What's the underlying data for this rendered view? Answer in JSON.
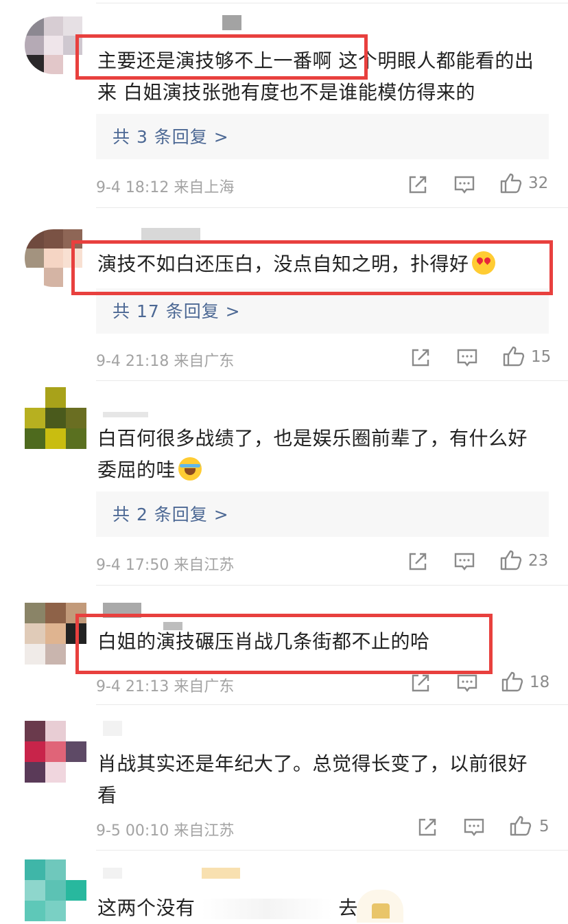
{
  "comments": [
    {
      "text": "主要还是演技够不上一番啊  这个明眼人都能看的出来 白姐演技张弛有度也不是谁能模仿得来的",
      "reply_label": "共 3 条回复 >",
      "time": "9-4 18:12",
      "location": "来自上海",
      "likes": "32"
    },
    {
      "text": "演技不如白还压白，没点自知之明，扑得好",
      "emoji": "heart-eyes-emoji",
      "reply_label": "共 17 条回复 >",
      "time": "9-4 21:18",
      "location": "来自广东",
      "likes": "15"
    },
    {
      "text": "白百何很多战绩了，也是娱乐圈前辈了，有什么好委屈的哇",
      "emoji": "crying-laughing-emoji",
      "reply_label": "共 2 条回复 >",
      "time": "9-4 17:50",
      "location": "来自江苏",
      "likes": "23"
    },
    {
      "text": "白姐的演技碾压肖战几条街都不止的哈",
      "time": "9-4 21:13",
      "location": "来自广东",
      "likes": "18"
    },
    {
      "text": "肖战其实还是年纪大了。总觉得长变了，以前很好看",
      "time": "9-5 00:10",
      "location": "来自江苏",
      "likes": "5"
    },
    {
      "text_start": "这两个没有",
      "text_end": "去"
    }
  ],
  "colors": {
    "highlight": "#e8403e",
    "reply_link": "#4c6894",
    "meta": "#a3a3a3"
  },
  "icons": [
    "share-icon",
    "comment-icon",
    "thumbs-up-icon"
  ]
}
